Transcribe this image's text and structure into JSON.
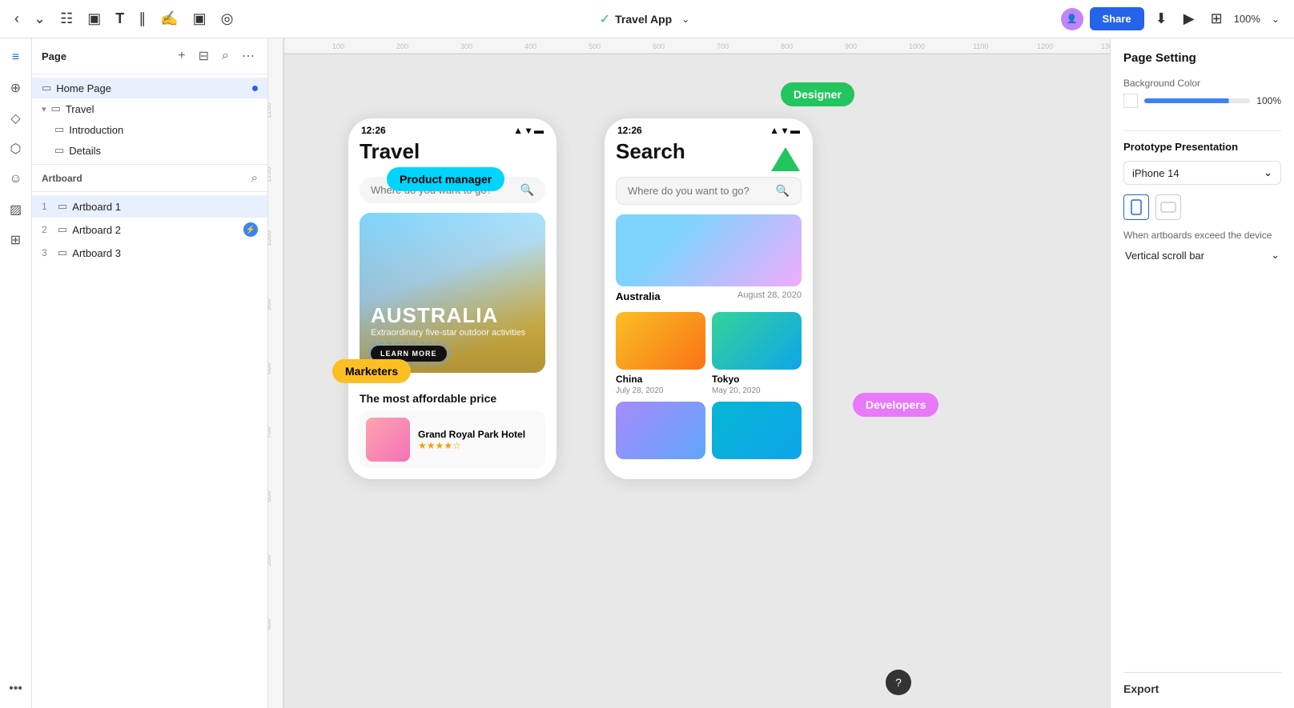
{
  "toolbar": {
    "app_title": "Travel App",
    "share_label": "Share",
    "zoom_level": "100%"
  },
  "sidebar": {
    "panel_title": "Page",
    "pages": [
      {
        "name": "Home Page",
        "level": 0,
        "selected": true,
        "has_dot": true
      },
      {
        "name": "Travel",
        "level": 0,
        "selected": false,
        "expandable": true
      },
      {
        "name": "Introduction",
        "level": 1,
        "selected": false
      },
      {
        "name": "Details",
        "level": 1,
        "selected": false
      }
    ],
    "artboard_title": "Artboard",
    "artboards": [
      {
        "num": "1",
        "name": "Artboard 1",
        "selected": true,
        "has_badge": false
      },
      {
        "num": "2",
        "name": "Artboard 2",
        "selected": false,
        "has_badge": true
      },
      {
        "num": "3",
        "name": "Artboard 3",
        "selected": false,
        "has_badge": false
      }
    ]
  },
  "canvas": {
    "frame1": {
      "time": "12:26",
      "title": "Travel",
      "search_placeholder": "Where do you want to go?",
      "hero_country": "AUSTRALIA",
      "hero_sub": "Extraordinary five-star outdoor activities",
      "hero_btn": "LEARN MORE",
      "section_label": "The most affordable price",
      "hotel_name": "Grand Royal Park Hotel"
    },
    "frame2": {
      "time": "12:26",
      "title": "Search",
      "search_placeholder": "Where do you want to go?",
      "article1_location": "Australia",
      "article1_date": "August 28, 2020",
      "article2_location": "China",
      "article2_date": "July 28, 2020",
      "article3_location": "Tokyo",
      "article3_date": "May 20, 2020"
    }
  },
  "bubbles": {
    "product_manager": "Product manager",
    "designer": "Designer",
    "marketers": "Marketers",
    "developers": "Developers"
  },
  "right_panel": {
    "title": "Page Setting",
    "bg_color_label": "Background Color",
    "bg_color_pct": "100%",
    "proto_title": "Prototype Presentation",
    "device_label": "iPhone 14",
    "exceed_label": "When artboards exceed the device",
    "exceed_value": "Vertical scroll bar",
    "export_label": "Export"
  }
}
